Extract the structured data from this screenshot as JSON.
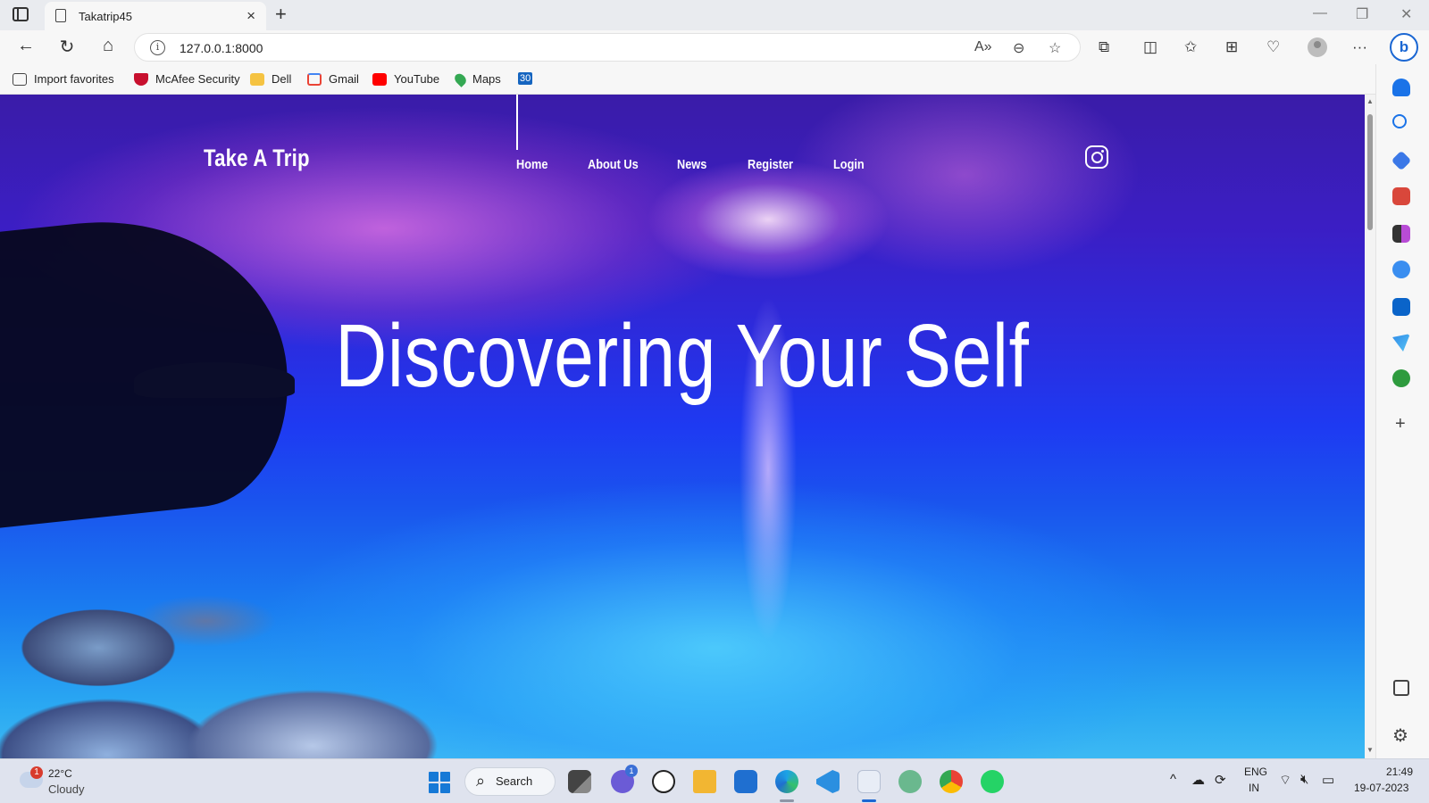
{
  "browser": {
    "tab_title": "Takatrip45",
    "url": "127.0.0.1:8000",
    "favorites": [
      {
        "label": "Import favorites",
        "icon": "import-icon"
      },
      {
        "label": "McAfee Security",
        "icon": "mcafee-icon",
        "color": "#c8102e"
      },
      {
        "label": "Dell",
        "icon": "folder-icon",
        "color": "#f5c342"
      },
      {
        "label": "Gmail",
        "icon": "gmail-icon",
        "color": "#ea4335"
      },
      {
        "label": "YouTube",
        "icon": "youtube-icon",
        "color": "#ff0000"
      },
      {
        "label": "Maps",
        "icon": "maps-icon",
        "color": "#34a853"
      },
      {
        "label": "30",
        "icon": "calendar-icon",
        "color": "#1565c0"
      }
    ]
  },
  "site": {
    "logo": "Take A Trip",
    "nav": [
      "Home",
      "About Us",
      "News",
      "Register",
      "Login"
    ],
    "hero_title": "Discovering Your Self",
    "social_icon": "instagram-icon"
  },
  "taskbar": {
    "weather_temp": "22°C",
    "weather_desc": "Cloudy",
    "weather_badge": "1",
    "search_label": "Search",
    "teams_badge": "1",
    "lang_line1": "ENG",
    "lang_line2": "IN",
    "time": "21:49",
    "date": "19-07-2023"
  },
  "colors": {
    "accent_blue": "#1b67d3",
    "sky_purple": "#3a1ca8",
    "sea_blue": "#1a7ef0"
  }
}
